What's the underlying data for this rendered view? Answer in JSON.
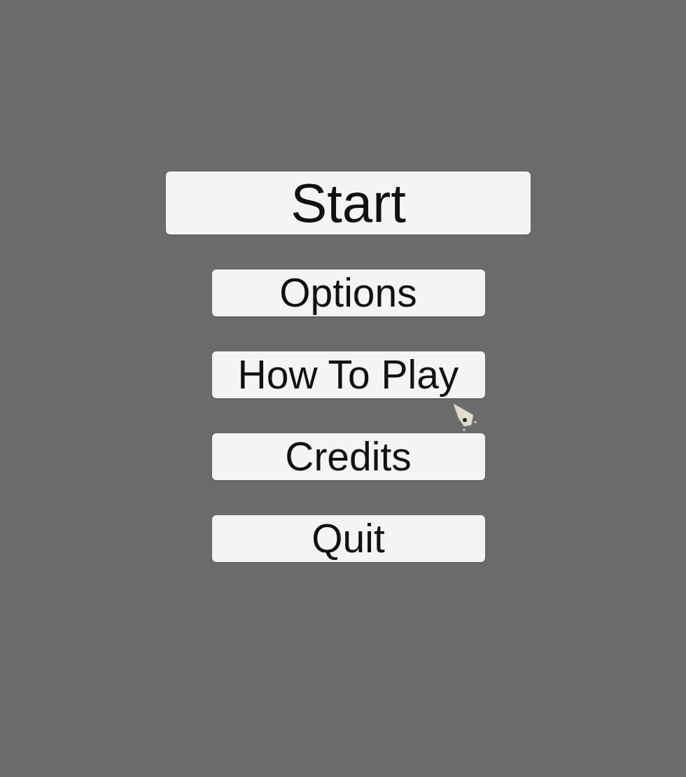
{
  "menu": {
    "buttons": [
      {
        "label": "Start",
        "kind": "large"
      },
      {
        "label": "Options",
        "kind": "regular"
      },
      {
        "label": "How To Play",
        "kind": "regular"
      },
      {
        "label": "Credits",
        "kind": "regular"
      },
      {
        "label": "Quit",
        "kind": "regular"
      }
    ]
  }
}
